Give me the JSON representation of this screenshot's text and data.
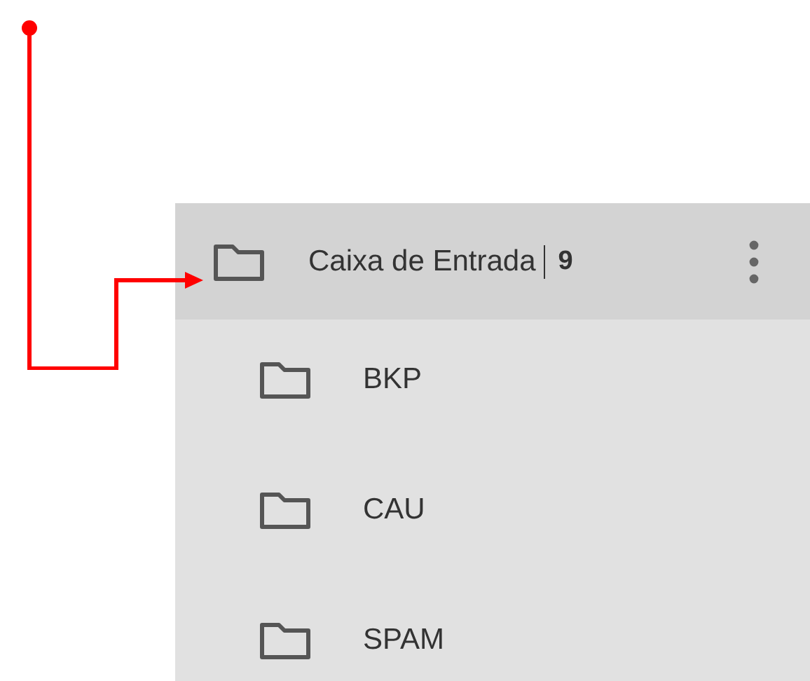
{
  "folder": {
    "label": "Caixa de Entrada",
    "count": "9",
    "selected": true,
    "children": [
      {
        "label": "BKP",
        "selected": false
      },
      {
        "label": "CAU",
        "selected": false
      },
      {
        "label": "SPAM",
        "selected": false
      }
    ]
  }
}
